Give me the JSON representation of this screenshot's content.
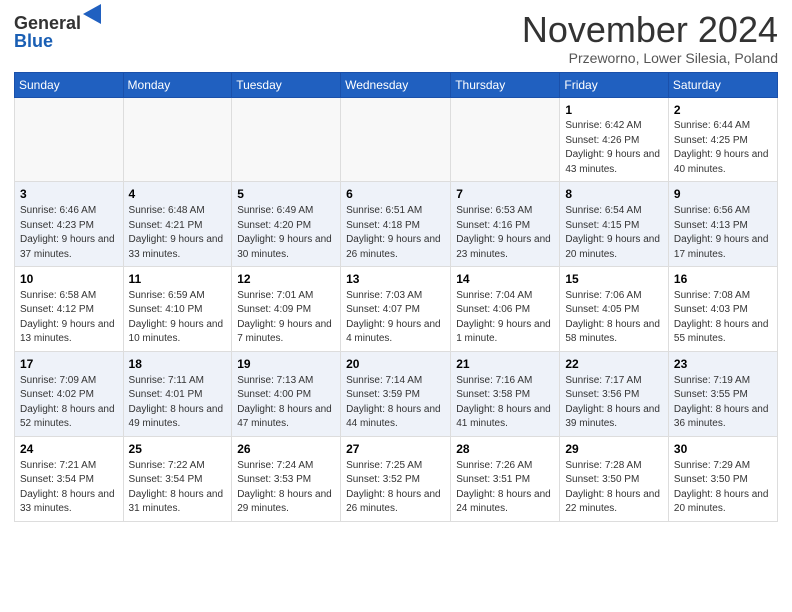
{
  "logo": {
    "general": "General",
    "blue": "Blue"
  },
  "header": {
    "month": "November 2024",
    "location": "Przeworno, Lower Silesia, Poland"
  },
  "weekdays": [
    "Sunday",
    "Monday",
    "Tuesday",
    "Wednesday",
    "Thursday",
    "Friday",
    "Saturday"
  ],
  "weeks": [
    [
      {
        "day": "",
        "info": ""
      },
      {
        "day": "",
        "info": ""
      },
      {
        "day": "",
        "info": ""
      },
      {
        "day": "",
        "info": ""
      },
      {
        "day": "",
        "info": ""
      },
      {
        "day": "1",
        "info": "Sunrise: 6:42 AM\nSunset: 4:26 PM\nDaylight: 9 hours and 43 minutes."
      },
      {
        "day": "2",
        "info": "Sunrise: 6:44 AM\nSunset: 4:25 PM\nDaylight: 9 hours and 40 minutes."
      }
    ],
    [
      {
        "day": "3",
        "info": "Sunrise: 6:46 AM\nSunset: 4:23 PM\nDaylight: 9 hours and 37 minutes."
      },
      {
        "day": "4",
        "info": "Sunrise: 6:48 AM\nSunset: 4:21 PM\nDaylight: 9 hours and 33 minutes."
      },
      {
        "day": "5",
        "info": "Sunrise: 6:49 AM\nSunset: 4:20 PM\nDaylight: 9 hours and 30 minutes."
      },
      {
        "day": "6",
        "info": "Sunrise: 6:51 AM\nSunset: 4:18 PM\nDaylight: 9 hours and 26 minutes."
      },
      {
        "day": "7",
        "info": "Sunrise: 6:53 AM\nSunset: 4:16 PM\nDaylight: 9 hours and 23 minutes."
      },
      {
        "day": "8",
        "info": "Sunrise: 6:54 AM\nSunset: 4:15 PM\nDaylight: 9 hours and 20 minutes."
      },
      {
        "day": "9",
        "info": "Sunrise: 6:56 AM\nSunset: 4:13 PM\nDaylight: 9 hours and 17 minutes."
      }
    ],
    [
      {
        "day": "10",
        "info": "Sunrise: 6:58 AM\nSunset: 4:12 PM\nDaylight: 9 hours and 13 minutes."
      },
      {
        "day": "11",
        "info": "Sunrise: 6:59 AM\nSunset: 4:10 PM\nDaylight: 9 hours and 10 minutes."
      },
      {
        "day": "12",
        "info": "Sunrise: 7:01 AM\nSunset: 4:09 PM\nDaylight: 9 hours and 7 minutes."
      },
      {
        "day": "13",
        "info": "Sunrise: 7:03 AM\nSunset: 4:07 PM\nDaylight: 9 hours and 4 minutes."
      },
      {
        "day": "14",
        "info": "Sunrise: 7:04 AM\nSunset: 4:06 PM\nDaylight: 9 hours and 1 minute."
      },
      {
        "day": "15",
        "info": "Sunrise: 7:06 AM\nSunset: 4:05 PM\nDaylight: 8 hours and 58 minutes."
      },
      {
        "day": "16",
        "info": "Sunrise: 7:08 AM\nSunset: 4:03 PM\nDaylight: 8 hours and 55 minutes."
      }
    ],
    [
      {
        "day": "17",
        "info": "Sunrise: 7:09 AM\nSunset: 4:02 PM\nDaylight: 8 hours and 52 minutes."
      },
      {
        "day": "18",
        "info": "Sunrise: 7:11 AM\nSunset: 4:01 PM\nDaylight: 8 hours and 49 minutes."
      },
      {
        "day": "19",
        "info": "Sunrise: 7:13 AM\nSunset: 4:00 PM\nDaylight: 8 hours and 47 minutes."
      },
      {
        "day": "20",
        "info": "Sunrise: 7:14 AM\nSunset: 3:59 PM\nDaylight: 8 hours and 44 minutes."
      },
      {
        "day": "21",
        "info": "Sunrise: 7:16 AM\nSunset: 3:58 PM\nDaylight: 8 hours and 41 minutes."
      },
      {
        "day": "22",
        "info": "Sunrise: 7:17 AM\nSunset: 3:56 PM\nDaylight: 8 hours and 39 minutes."
      },
      {
        "day": "23",
        "info": "Sunrise: 7:19 AM\nSunset: 3:55 PM\nDaylight: 8 hours and 36 minutes."
      }
    ],
    [
      {
        "day": "24",
        "info": "Sunrise: 7:21 AM\nSunset: 3:54 PM\nDaylight: 8 hours and 33 minutes."
      },
      {
        "day": "25",
        "info": "Sunrise: 7:22 AM\nSunset: 3:54 PM\nDaylight: 8 hours and 31 minutes."
      },
      {
        "day": "26",
        "info": "Sunrise: 7:24 AM\nSunset: 3:53 PM\nDaylight: 8 hours and 29 minutes."
      },
      {
        "day": "27",
        "info": "Sunrise: 7:25 AM\nSunset: 3:52 PM\nDaylight: 8 hours and 26 minutes."
      },
      {
        "day": "28",
        "info": "Sunrise: 7:26 AM\nSunset: 3:51 PM\nDaylight: 8 hours and 24 minutes."
      },
      {
        "day": "29",
        "info": "Sunrise: 7:28 AM\nSunset: 3:50 PM\nDaylight: 8 hours and 22 minutes."
      },
      {
        "day": "30",
        "info": "Sunrise: 7:29 AM\nSunset: 3:50 PM\nDaylight: 8 hours and 20 minutes."
      }
    ]
  ]
}
